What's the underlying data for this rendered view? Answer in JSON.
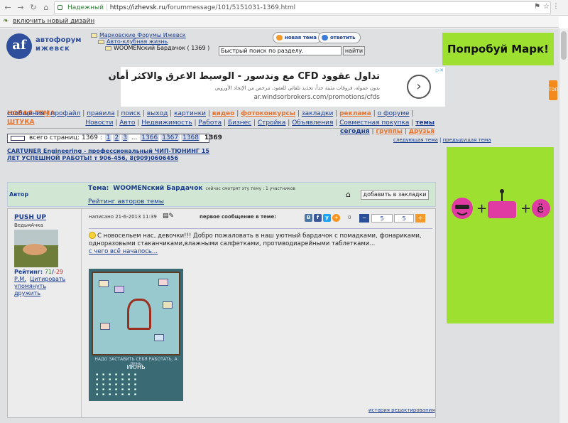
{
  "browser": {
    "secure_label": "Надежный",
    "url_host": "https://izhevsk.ru",
    "url_path": "/forummessage/101/5151031-1369.html"
  },
  "design_bar": {
    "label": "включить новый дизайн"
  },
  "logo": {
    "mark": "af",
    "line1": "автофорум",
    "line2": "ижевск"
  },
  "breadcrumbs": {
    "level1": "Марковские Форумы Ижевск",
    "level2": "Авто-клубная жизнь",
    "level3": "WOOMENский Бардачок",
    "level3_count": "( 1369 )"
  },
  "buttons": {
    "new_topic": "новая тема",
    "reply": "ответить"
  },
  "search": {
    "placeholder": "Быстрый поиск по разделу.",
    "button": "найти"
  },
  "ads": {
    "mark_banner": "Попробуй Марк!",
    "cfd_headline": "تداول عقوود CFD مع وندسور - الوسيط الاعرق والاكثر أمان",
    "cfd_sub": "بدون عمولة، فروقات مثبتة جداً، تجديد تلقائي للعقود، مرخص من الإتحاد الأوروبي",
    "cfd_url": "ar.windsorbrokers.com/promotions/cfds",
    "side_tab": "ТОП"
  },
  "nav": {
    "new_topic": "НОВАЯ ТЕМА",
    "row1": [
      "сообщения",
      "профайл",
      "правила",
      "поиск",
      "выход",
      "картинки",
      "видео",
      "фотоконкурсы",
      "закладки",
      "реклама",
      "о форуме",
      "ШТУКА"
    ],
    "row2": [
      "Новости",
      "Авто",
      "Недвижимость",
      "Работа",
      "Бизнес",
      "Стройка",
      "Объявления",
      "Совместная покупка",
      "темы сегодня",
      "группы",
      "друзья"
    ]
  },
  "pager": {
    "label": "всего страниц: 1369 :",
    "pages": [
      "1",
      "2",
      "3"
    ],
    "ellipsis": "...",
    "late_pages": [
      "1366",
      "1367",
      "1368"
    ],
    "current": "1369"
  },
  "topic_nav": {
    "next": "следующая тема",
    "prev": "предыдущая тема"
  },
  "cartuner": {
    "line1": "CARTUNER Engineering - профессиональный ЧИП-ТЮНИНГ 15",
    "line2": "ЛЕТ УСПЕШНОЙ РАБОТЫ! т 906-456, 8(909)0606456"
  },
  "topic_header": {
    "author_label": "Автор",
    "topic_label": "Тема:",
    "topic_name": "WOOMENский Бардачок",
    "viewers": "сейчас смотрят эту тему : 1 участников",
    "authors_rating": "Рейтинг авторов темы",
    "bookmark": "добавить в закладки"
  },
  "post": {
    "author": "PUSH UP",
    "status": "ВедьмАчка",
    "rating_label": "Рейтинг:",
    "rating_pos": "71",
    "rating_neg": "-29",
    "pm": "Р.М.",
    "quote": "Цитировать",
    "mention": "упомянуть",
    "befriend": "дружить",
    "written": "написано 21-6-2013 11:39",
    "first_message": "первое сообщение в теме:",
    "social": [
      "В",
      "f",
      "у",
      "+"
    ],
    "share_count": "0",
    "vote_minus": "−",
    "vote_a": "5",
    "vote_b": "5",
    "vote_plus": "+",
    "text": "С новосельем нас, девочки!!! Добро пожаловать в наш уютный бардачок с помадками, фонариками, одноразовыми стаканчиками,влажными салфетками, противодиарейными таблетками...",
    "more_link": "с чего всё началось...",
    "image_caption": "НАДО ЗАСТАВИТЬ СЕБЯ РАБОТАТЬ, А ЛЕНЬ",
    "image_month": "ИЮНЬ",
    "history": "история редактирования"
  },
  "colors": {
    "accent_orange": "#e8732d",
    "link_blue": "#1a3d8f",
    "ad_green": "#9de030"
  }
}
